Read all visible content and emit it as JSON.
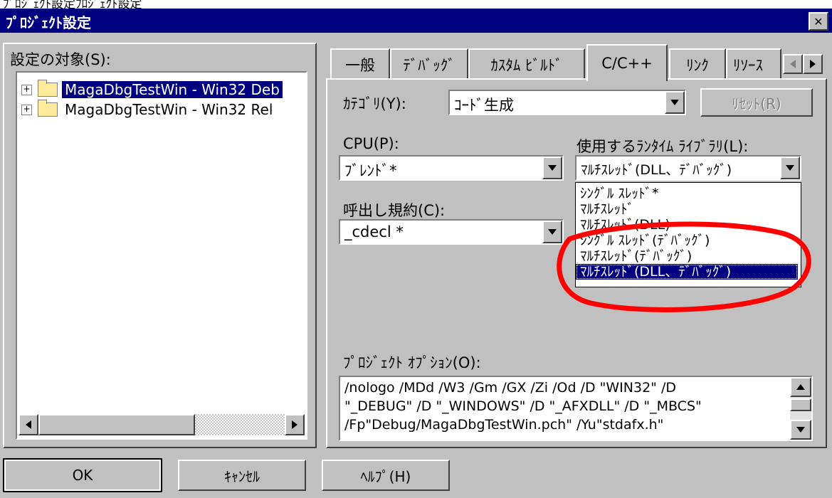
{
  "top_strip_text": "ﾌﾟﾛｼﾞｪｸﾄ設定ﾌﾛｼﾞｪｸﾄ設定",
  "window": {
    "title": "ﾌﾟﾛｼﾞｪｸﾄ設定",
    "close_glyph": "✕"
  },
  "settings_target": {
    "label": "設定の対象(S):",
    "items": [
      {
        "label": "MagaDbgTestWin - Win32 Deb",
        "selected": true
      },
      {
        "label": "MagaDbgTestWin - Win32 Rel",
        "selected": false
      }
    ]
  },
  "tabs": [
    {
      "label": "一般",
      "active": false
    },
    {
      "label": "ﾃﾞﾊﾞｯｸﾞ",
      "active": false
    },
    {
      "label": "ｶｽﾀﾑ ﾋﾞﾙﾄﾞ",
      "active": false
    },
    {
      "label": "C/C++",
      "active": true
    },
    {
      "label": "ﾘﾝｸ",
      "active": false
    },
    {
      "label": "ﾘｿｰｽ",
      "active": false
    }
  ],
  "category": {
    "label": "ｶﾃｺﾞﾘ(Y):",
    "value": "ｺｰﾄﾞ生成"
  },
  "reset_button": "ﾘｾｯﾄ(R)",
  "cpu": {
    "label": "CPU(P):",
    "value": "ﾌﾞﾚﾝﾄﾞ*"
  },
  "calling_convention": {
    "label": "呼出し規約(C):",
    "value": "_cdecl *"
  },
  "runtime_library": {
    "label": "使用するﾗﾝﾀｲﾑ ﾗｲﾌﾞﾗﾘ(L):",
    "value": "ﾏﾙﾁｽﾚｯﾄﾞ(DLL、ﾃﾞﾊﾞｯｸﾞ)",
    "options": [
      {
        "label": "ｼﾝｸﾞﾙ ｽﾚｯﾄﾞ*",
        "selected": false
      },
      {
        "label": "ﾏﾙﾁｽﾚｯﾄﾞ",
        "selected": false
      },
      {
        "label": "ﾏﾙﾁｽﾚｯﾄﾞ(DLL)",
        "selected": false
      },
      {
        "label": "ｼﾝｸﾞﾙ ｽﾚｯﾄﾞ(ﾃﾞﾊﾞｯｸﾞ)",
        "selected": false
      },
      {
        "label": "ﾏﾙﾁｽﾚｯﾄﾞ(ﾃﾞﾊﾞｯｸﾞ)",
        "selected": false
      },
      {
        "label": "ﾏﾙﾁｽﾚｯﾄﾞ(DLL、ﾃﾞﾊﾞｯｸﾞ)",
        "selected": true
      }
    ]
  },
  "project_options": {
    "label": "ﾌﾟﾛｼﾞｪｸﾄ ｵﾌﾟｼｮﾝ(O):",
    "lines": [
      "/nologo /MDd /W3 /Gm /GX /Zi /Od /D \"WIN32\" /D",
      "\"_DEBUG\" /D \"_WINDOWS\" /D \"_AFXDLL\" /D \"_MBCS\"",
      "/Fp\"Debug/MagaDbgTestWin.pch\" /Yu\"stdafx.h\""
    ]
  },
  "buttons": {
    "ok": "OK",
    "cancel": "ｷｬﾝｾﾙ",
    "help": "ﾍﾙﾌﾟ(H)"
  },
  "colors": {
    "title_bar": "#000080",
    "selection": "#000080",
    "annotation": "#ff0000",
    "face": "#c0c0c0"
  }
}
